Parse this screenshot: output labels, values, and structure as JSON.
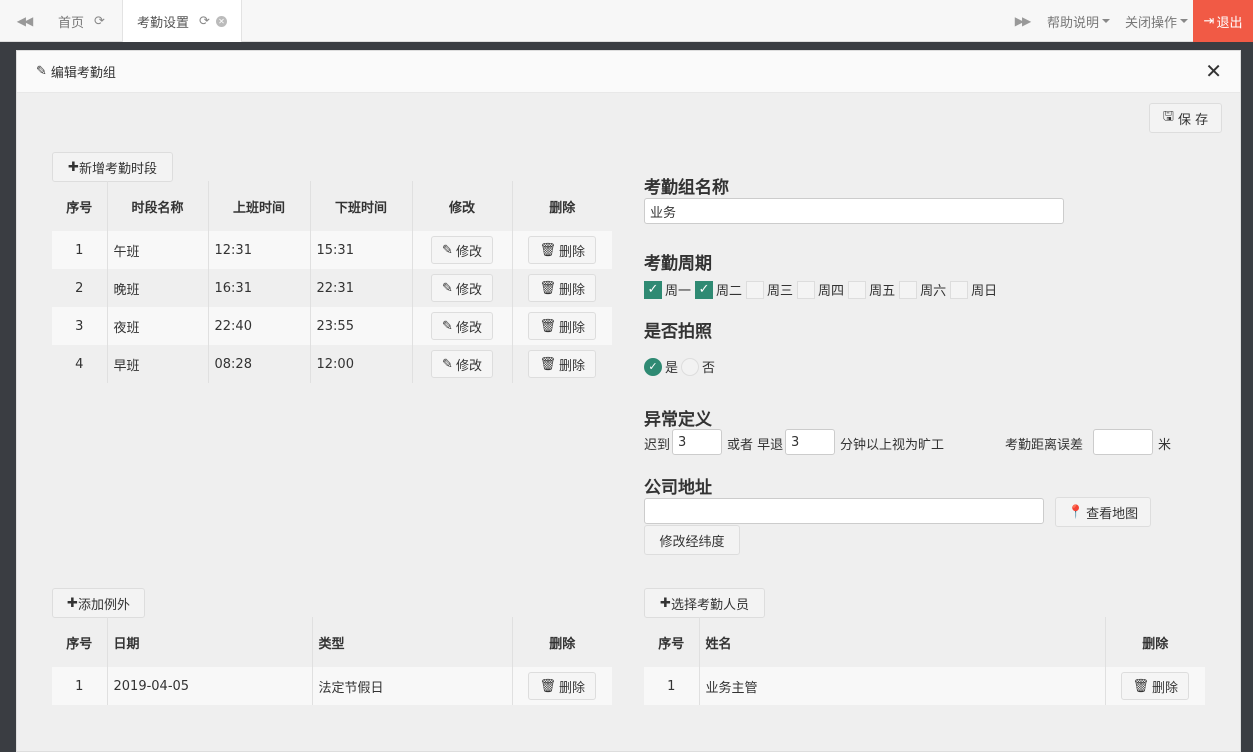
{
  "topbar": {
    "tabs": [
      {
        "label": "首页"
      },
      {
        "label": "考勤设置"
      }
    ],
    "help_label": "帮助说明",
    "close_ops_label": "关闭操作",
    "logout_label": "退出"
  },
  "modal": {
    "title": "编辑考勤组",
    "save_label": "保 存"
  },
  "shifts": {
    "add_label": "新增考勤时段",
    "headers": [
      "序号",
      "时段名称",
      "上班时间",
      "下班时间",
      "修改",
      "删除"
    ],
    "edit_label": "修改",
    "delete_label": "删除",
    "rows": [
      {
        "no": "1",
        "name": "午班",
        "start": "12:31",
        "end": "15:31"
      },
      {
        "no": "2",
        "name": "晚班",
        "start": "16:31",
        "end": "22:31"
      },
      {
        "no": "3",
        "name": "夜班",
        "start": "22:40",
        "end": "23:55"
      },
      {
        "no": "4",
        "name": "早班",
        "start": "08:28",
        "end": "12:00"
      }
    ]
  },
  "group": {
    "name_title": "考勤组名称",
    "name_value": "业务",
    "cycle_title": "考勤周期",
    "days": [
      {
        "label": "周一",
        "checked": true
      },
      {
        "label": "周二",
        "checked": true
      },
      {
        "label": "周三",
        "checked": false
      },
      {
        "label": "周四",
        "checked": false
      },
      {
        "label": "周五",
        "checked": false
      },
      {
        "label": "周六",
        "checked": false
      },
      {
        "label": "周日",
        "checked": false
      }
    ],
    "photo_title": "是否拍照",
    "photo_yes": "是",
    "photo_no": "否",
    "photo_selected": "是",
    "abnormal_title": "异常定义",
    "late_label": "迟到",
    "late_value": "3",
    "or_early_label": "或者 早退",
    "early_value": "3",
    "absent_label": "分钟以上视为旷工",
    "distance_label": "考勤距离误差",
    "distance_value": "",
    "meter_label": "米",
    "address_title": "公司地址",
    "address_value": "",
    "map_label": "查看地图",
    "latlng_label": "修改经纬度"
  },
  "exceptions": {
    "add_label": "添加例外",
    "headers": [
      "序号",
      "日期",
      "类型",
      "删除"
    ],
    "delete_label": "删除",
    "rows": [
      {
        "no": "1",
        "date": "2019-04-05",
        "type": "法定节假日"
      }
    ]
  },
  "staff": {
    "add_label": "选择考勤人员",
    "headers": [
      "序号",
      "姓名",
      "删除"
    ],
    "delete_label": "删除",
    "rows": [
      {
        "no": "1",
        "name": "业务主管"
      }
    ]
  },
  "colors": {
    "accent": "#2f8a73",
    "logout": "#f15a45"
  }
}
